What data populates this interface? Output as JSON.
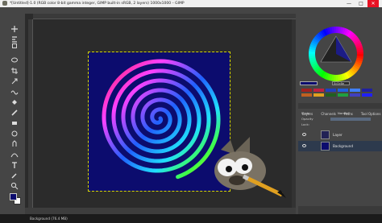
{
  "window": {
    "title": "*[Untitled]-1.0 (RGB color 8-bit gamma integer, GIMP built-in sRGB, 2 layers) 1000x1000 – GIMP",
    "min": "—",
    "max": "□",
    "close": "✕"
  },
  "menu": [
    "File",
    "Edit",
    "Select",
    "View",
    "Image",
    "Layer",
    "Colors",
    "Tools",
    "Filters",
    "Windows",
    "Help"
  ],
  "status": {
    "text": "Background (76.4 MB)"
  },
  "colors": {
    "hex_value": "0c0c6e",
    "fg": "#0c0c6e",
    "bg": "#ffffff",
    "palette": [
      "#a02020",
      "#c02040",
      "#2040c0",
      "#2060e0",
      "#4080ff",
      "#2020a0",
      "#c06020",
      "#e0a020",
      "#206020",
      "#20a040",
      "#4040c0",
      "#2020ff"
    ]
  },
  "tabs": {
    "layers": "Layers",
    "channels": "Channels",
    "paths": "Paths",
    "tool_options": "Tool Options"
  },
  "layers_panel": {
    "mode_label": "Mode",
    "mode_value": "Normal",
    "opacity_label": "Opacity",
    "lock_label": "Lock:"
  },
  "layers": [
    {
      "name": "Layer",
      "selected": false
    },
    {
      "name": "Background",
      "selected": true
    }
  ]
}
